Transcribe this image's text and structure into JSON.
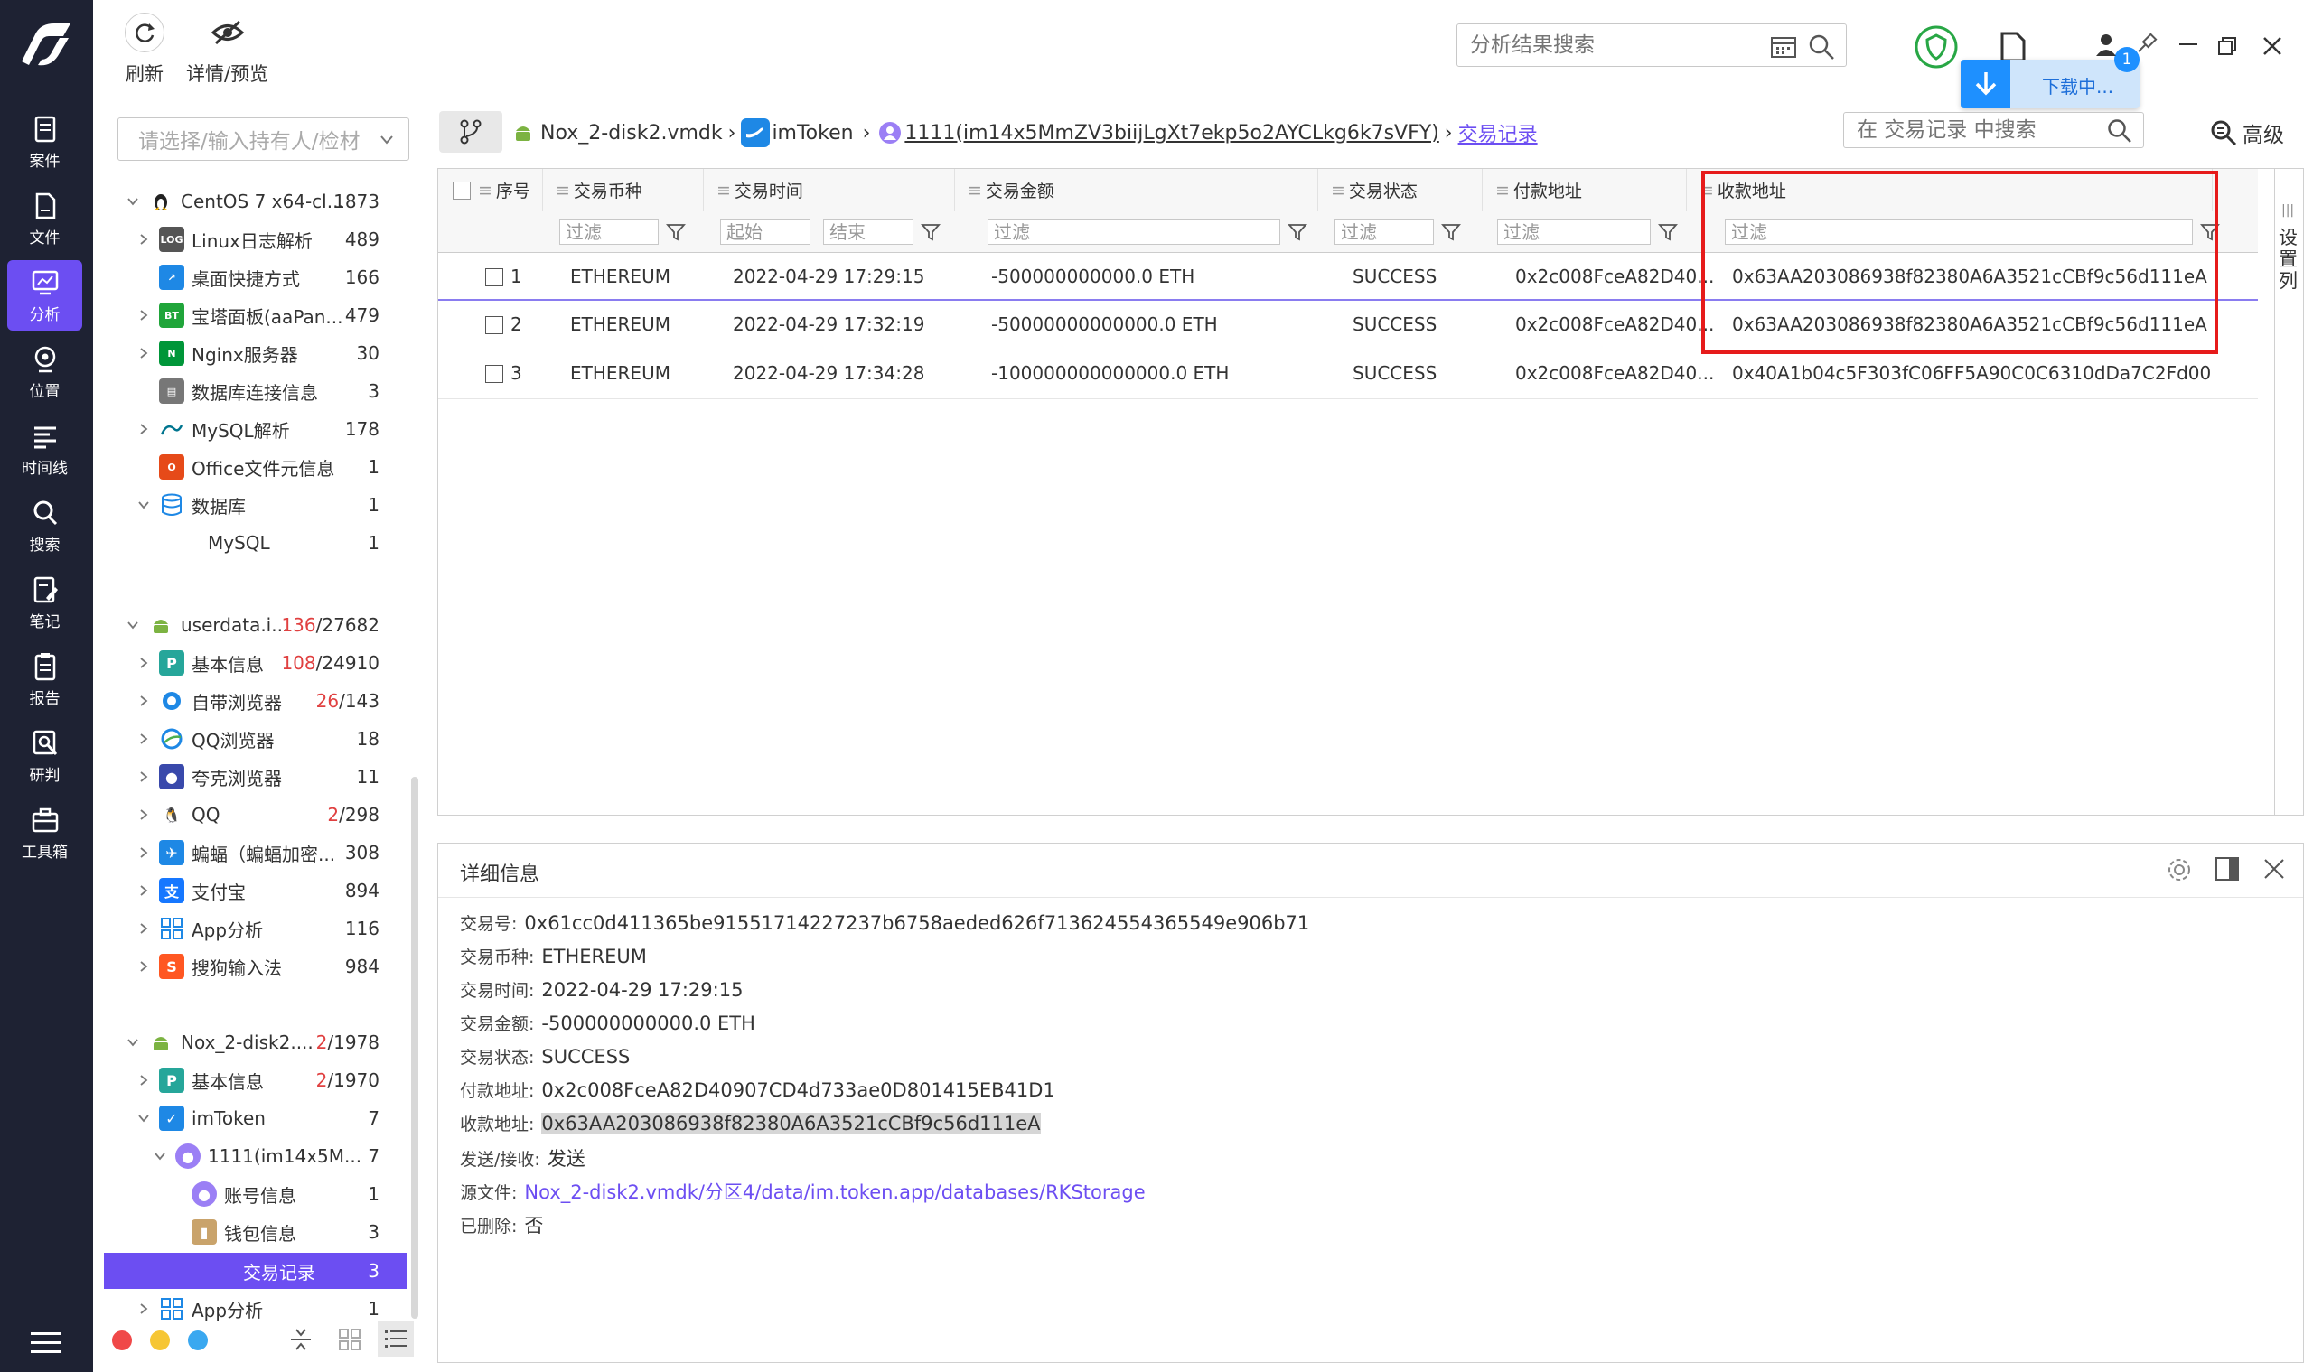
{
  "leftnav": {
    "items": [
      {
        "label": "案件",
        "icon": "case-icon"
      },
      {
        "label": "文件",
        "icon": "file-icon"
      },
      {
        "label": "分析",
        "icon": "analysis-icon"
      },
      {
        "label": "位置",
        "icon": "location-icon"
      },
      {
        "label": "时间线",
        "icon": "timeline-icon"
      },
      {
        "label": "搜索",
        "icon": "search-icon"
      },
      {
        "label": "笔记",
        "icon": "note-icon"
      },
      {
        "label": "报告",
        "icon": "report-icon"
      },
      {
        "label": "研判",
        "icon": "judge-icon"
      },
      {
        "label": "工具箱",
        "icon": "toolbox-icon"
      }
    ]
  },
  "toolbar": {
    "refresh_label": "刷新",
    "detail_label": "详情/预览"
  },
  "top_search": {
    "placeholder": "分析结果搜索"
  },
  "download": {
    "label": "下载中...",
    "badge": "1"
  },
  "owner_select": {
    "placeholder": "请选择/输入持有人/检材"
  },
  "breadcrumb": {
    "items": [
      "Nox_2-disk2.vmdk",
      "imToken",
      "1111(im14x5MmZV3biijLgXt7ekp5o2AYCLkg6k7sVFY)",
      "交易记录"
    ]
  },
  "table_search": {
    "placeholder": "在 交易记录 中搜索"
  },
  "advanced_label": "高级",
  "settings_column_label": "设置列",
  "tree": {
    "centos": {
      "label": "CentOS 7 x64-cl...",
      "count": "1873"
    },
    "centos_children": [
      {
        "label": "Linux日志解析",
        "count": "489"
      },
      {
        "label": "桌面快捷方式",
        "count": "166"
      },
      {
        "label": "宝塔面板(aaPan...",
        "count": "479"
      },
      {
        "label": "Nginx服务器",
        "count": "30"
      },
      {
        "label": "数据库连接信息",
        "count": "3"
      },
      {
        "label": "MySQL解析",
        "count": "178"
      },
      {
        "label": "Office文件元信息",
        "count": "1"
      },
      {
        "label": "数据库",
        "count": "1"
      },
      {
        "label": "MySQL",
        "count": "1"
      }
    ],
    "userdata": {
      "label": "userdata.i...",
      "count_red": "136",
      "count_total": "/27682"
    },
    "userdata_children": [
      {
        "label": "基本信息",
        "count_red": "108",
        "count_total": "/24910"
      },
      {
        "label": "自带浏览器",
        "count_red": "26",
        "count_total": "/143"
      },
      {
        "label": "QQ浏览器",
        "count": "18"
      },
      {
        "label": "夸克浏览器",
        "count": "11"
      },
      {
        "label": "QQ",
        "count_red": "2",
        "count_total": "/298"
      },
      {
        "label": "蝙蝠（蝙蝠加密...",
        "count": "308"
      },
      {
        "label": "支付宝",
        "count": "894"
      },
      {
        "label": "App分析",
        "count": "116"
      },
      {
        "label": "搜狗输入法",
        "count": "984"
      }
    ],
    "nox": {
      "label": "Nox_2-disk2....",
      "count_red": "2",
      "count_total": "/1978"
    },
    "nox_children": [
      {
        "label": "基本信息",
        "count_red": "2",
        "count_total": "/1970"
      },
      {
        "label": "imToken",
        "count": "7"
      },
      {
        "label": "1111(im14x5M...",
        "count": "7"
      },
      {
        "label": "账号信息",
        "count": "1"
      },
      {
        "label": "钱包信息",
        "count": "3"
      },
      {
        "label": "交易记录",
        "count": "3"
      },
      {
        "label": "App分析",
        "count": "1"
      }
    ]
  },
  "grid": {
    "columns": [
      "序号",
      "交易币种",
      "交易时间",
      "交易金额",
      "交易状态",
      "付款地址",
      "收款地址"
    ],
    "filter_placeholder": "过滤",
    "time_start": "起始",
    "time_end": "结束",
    "rows": [
      {
        "no": "1",
        "currency": "ETHEREUM",
        "time": "2022-04-29 17:29:15",
        "amount": "-500000000000.0 ETH",
        "status": "SUCCESS",
        "from": "0x2c008FceA82D40...",
        "to": "0x63AA203086938f82380A6A3521cCBf9c56d111eA"
      },
      {
        "no": "2",
        "currency": "ETHEREUM",
        "time": "2022-04-29 17:32:19",
        "amount": "-50000000000000.0 ETH",
        "status": "SUCCESS",
        "from": "0x2c008FceA82D40...",
        "to": "0x63AA203086938f82380A6A3521cCBf9c56d111eA"
      },
      {
        "no": "3",
        "currency": "ETHEREUM",
        "time": "2022-04-29 17:34:28",
        "amount": "-100000000000000.0 ETH",
        "status": "SUCCESS",
        "from": "0x2c008FceA82D40...",
        "to": "0x40A1b04c5F303fC06FF5A90C0C6310dDa7C2Fd00"
      }
    ]
  },
  "detail": {
    "title": "详细信息",
    "fields": [
      {
        "label": "交易号:",
        "value": "0x61cc0d411365be91551714227237b6758aeded626f713624554365549e906b71"
      },
      {
        "label": "交易币种:",
        "value": "ETHEREUM"
      },
      {
        "label": "交易时间:",
        "value": "2022-04-29 17:29:15"
      },
      {
        "label": "交易金额:",
        "value": "-500000000000.0 ETH"
      },
      {
        "label": "交易状态:",
        "value": "SUCCESS"
      },
      {
        "label": "付款地址:",
        "value": "0x2c008FceA82D40907CD4d733ae0D801415EB41D1"
      },
      {
        "label": "收款地址:",
        "value": "0x63AA203086938f82380A6A3521cCBf9c56d111eA"
      },
      {
        "label": "发送/接收:",
        "value": "发送"
      },
      {
        "label": "源文件:",
        "value": "Nox_2-disk2.vmdk/分区4/data/im.token.app/databases/RKStorage"
      },
      {
        "label": "已删除:",
        "value": "否"
      }
    ]
  },
  "colors": {
    "accent": "#6c4ef2",
    "nav_bg": "#1e2233",
    "highlight": "#e61b1b"
  }
}
